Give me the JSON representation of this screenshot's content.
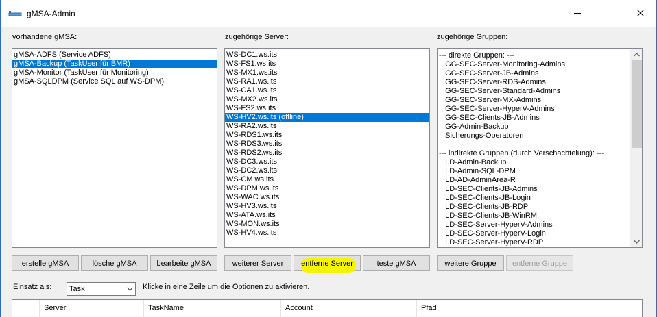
{
  "window": {
    "title": "gMSA-Admin"
  },
  "labels": {
    "gmsa": "vorhandene gMSA:",
    "server": "zugehörige Server:",
    "groups": "zugehörige Gruppen:",
    "einsatz": "Einsatz als:",
    "hint": "Klicke in eine Zeile um die Optionen zu aktivieren."
  },
  "gmsa_list": [
    {
      "label": "gMSA-ADFS (Service ADFS)",
      "selected": false
    },
    {
      "label": "gMSA-Backup (TaskUser für BMR)",
      "selected": true
    },
    {
      "label": "gMSA-Monitor (TaskUser für Monitoring)",
      "selected": false
    },
    {
      "label": "gMSA-SQLDPM (Service SQL auf WS-DPM)",
      "selected": false
    }
  ],
  "server_list": [
    {
      "label": "WS-DC1.ws.its",
      "selected": false
    },
    {
      "label": "WS-FS1.ws.its",
      "selected": false
    },
    {
      "label": "WS-MX1.ws.its",
      "selected": false
    },
    {
      "label": "WS-RA1.ws.its",
      "selected": false
    },
    {
      "label": "WS-CA1.ws.its",
      "selected": false
    },
    {
      "label": "WS-MX2.ws.its",
      "selected": false
    },
    {
      "label": "WS-FS2.ws.its",
      "selected": false
    },
    {
      "label": "WS-HV2.ws.its (offline)",
      "selected": true
    },
    {
      "label": "WS-RA2.ws.its",
      "selected": false
    },
    {
      "label": "WS-RDS1.ws.its",
      "selected": false
    },
    {
      "label": "WS-RDS3.ws.its",
      "selected": false
    },
    {
      "label": "WS-RDS2.ws.its",
      "selected": false
    },
    {
      "label": "WS-DC3.ws.its",
      "selected": false
    },
    {
      "label": "WS-DC2.ws.its",
      "selected": false
    },
    {
      "label": "WS-CM.ws.its",
      "selected": false
    },
    {
      "label": "WS-DPM.ws.its",
      "selected": false
    },
    {
      "label": "WS-WAC.ws.its",
      "selected": false
    },
    {
      "label": "WS-HV3.ws.its",
      "selected": false
    },
    {
      "label": "WS-ATA.ws.its",
      "selected": false
    },
    {
      "label": "WS-MON.ws.its",
      "selected": false
    },
    {
      "label": "WS-HV4.ws.its",
      "selected": false
    }
  ],
  "group_list": [
    "--- direkte Gruppen: ---",
    "   GG-SEC-Server-Monitoring-Admins",
    "   GG-SEC-Server-JB-Admins",
    "   GG-SEC-Server-RDS-Admins",
    "   GG-SEC-Server-Standard-Admins",
    "   GG-SEC-Server-MX-Admins",
    "   GG-SEC-Server-HyperV-Admins",
    "   GG-SEC-Clients-JB-Admins",
    "   GG-Admin-Backup",
    "   Sicherungs-Operatoren",
    "",
    "--- indirekte Gruppen (durch Verschachtelung): ---",
    "   LD-Admin-Backup",
    "   LD-Admin-SQL-DPM",
    "   LD-AD-AdminArea-R",
    "   LD-SEC-Clients-JB-Admins",
    "   LD-SEC-Clients-JB-Login",
    "   LD-SEC-Clients-JB-RDP",
    "   LD-SEC-Clients-JB-WinRM",
    "   LD-SEC-Server-HyperV-Admins",
    "   LD-SEC-Server-HyperV-Login",
    "   LD-SEC-Server-HyperV-RDP"
  ],
  "buttons": {
    "create": "erstelle gMSA",
    "delete": "lösche gMSA",
    "edit": "bearbeite gMSA",
    "add_server": "weiterer Server",
    "remove_server": "entferne Server",
    "test": "teste gMSA",
    "add_group": "weitere Gruppe",
    "remove_group": "entferne Gruppe"
  },
  "combo": {
    "value": "Task"
  },
  "grid": {
    "columns": [
      "Server",
      "TaskName",
      "Account",
      "Pfad"
    ]
  },
  "colors": {
    "selection": "#0078d7",
    "highlight": "#f5f500"
  }
}
